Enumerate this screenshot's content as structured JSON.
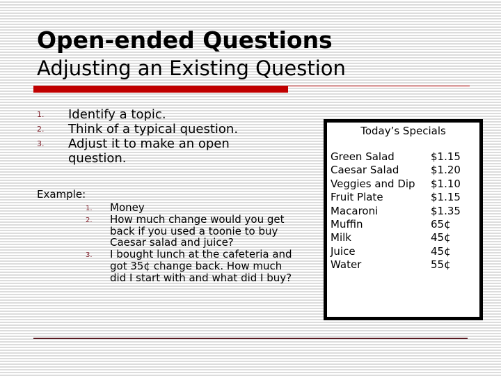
{
  "slide": {
    "title": "Open-ended Questions",
    "subtitle": "Adjusting an Existing Question",
    "steps": [
      {
        "number": "1.",
        "text": "Identify a topic."
      },
      {
        "number": "2.",
        "text": "Think of a typical question."
      },
      {
        "number": "3.",
        "text": "Adjust it to make an open question."
      }
    ],
    "example_label": "Example:",
    "example_steps": [
      {
        "number": "1.",
        "text": "Money"
      },
      {
        "number": "2.",
        "text": "How much change would you get back if you used a toonie to buy Caesar salad and juice?"
      },
      {
        "number": "3.",
        "text": "I bought lunch at the cafeteria and got 35¢ change back. How much did I start with and what did I buy?"
      }
    ],
    "specials": {
      "title": "Today’s Specials",
      "items": [
        {
          "name": "Green Salad",
          "price": "$1.15"
        },
        {
          "name": "Caesar Salad",
          "price": "$1.20"
        },
        {
          "name": "Veggies and Dip",
          "price": "$1.10"
        },
        {
          "name": "Fruit Plate",
          "price": "$1.15"
        },
        {
          "name": "Macaroni",
          "price": "$1.35"
        },
        {
          "name": "Muffin",
          "price": "65¢"
        },
        {
          "name": "Milk",
          "price": "45¢"
        },
        {
          "name": "Juice",
          "price": "45¢"
        },
        {
          "name": "Water",
          "price": "55¢"
        }
      ]
    },
    "colors": {
      "accent_red": "#c00000",
      "list_number": "#7f1f2a",
      "footer_line": "#5a1a22"
    }
  }
}
